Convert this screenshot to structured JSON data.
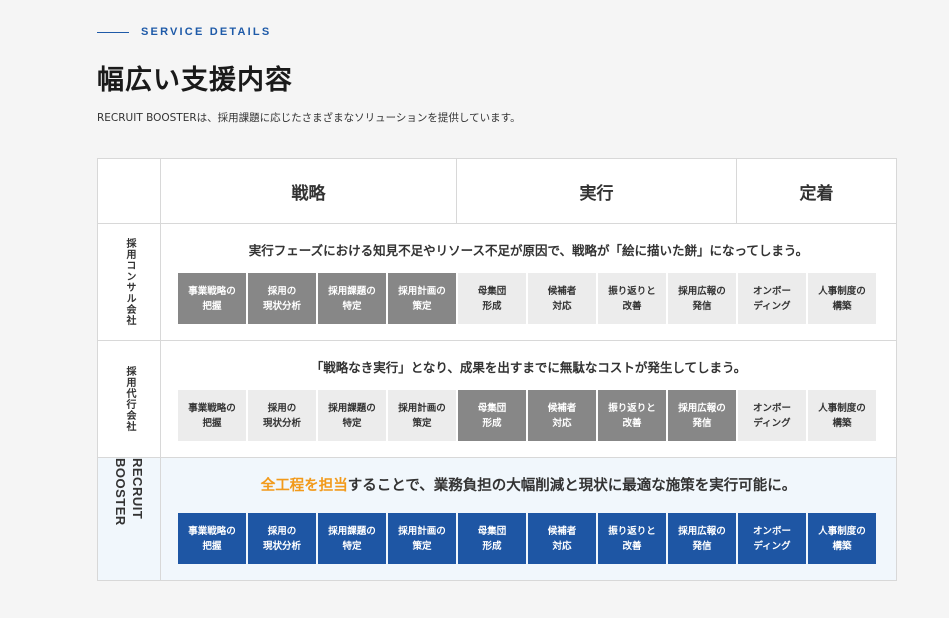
{
  "section": {
    "eyebrow": "SERVICE DETAILS",
    "title": "幅広い支援内容",
    "lead": "RECRUIT BOOSTERは、採用課題に応じたさまざまなソリューションを提供しています。"
  },
  "table": {
    "columns": [
      "戦略",
      "実行",
      "定着"
    ],
    "rows": [
      {
        "label": "採用コンサル会社",
        "message": "実行フェーズにおける知見不足やリソース不足が原因で、戦略が「絵に描いた餅」になってしまう。",
        "chip_states": [
          "gray",
          "gray",
          "gray",
          "gray",
          "off",
          "off",
          "off",
          "off",
          "off",
          "off"
        ]
      },
      {
        "label": "採用代行会社",
        "message": "「戦略なき実行」となり、成果を出すまでに無駄なコストが発生してしまう。",
        "chip_states": [
          "off",
          "off",
          "off",
          "off",
          "gray",
          "gray",
          "gray",
          "gray",
          "off",
          "off"
        ]
      },
      {
        "label": "RECRUIT BOOSTER",
        "message_highlight": "全工程を担当",
        "message_rest": "することで、業務負担の大幅削減と現状に最適な施策を実行可能に。",
        "chip_states": [
          "blue",
          "blue",
          "blue",
          "blue",
          "blue",
          "blue",
          "blue",
          "blue",
          "blue",
          "blue"
        ]
      }
    ],
    "chips": [
      {
        "line1": "事業戦略の",
        "line2": "把握"
      },
      {
        "line1": "採用の",
        "line2": "現状分析"
      },
      {
        "line1": "採用課題の",
        "line2": "特定"
      },
      {
        "line1": "採用計画の",
        "line2": "策定"
      },
      {
        "line1": "母集団",
        "line2": "形成"
      },
      {
        "line1": "候補者",
        "line2": "対応"
      },
      {
        "line1": "振り返りと",
        "line2": "改善"
      },
      {
        "line1": "採用広報の",
        "line2": "発信"
      },
      {
        "line1": "オンボー",
        "line2": "ディング"
      },
      {
        "line1": "人事制度の",
        "line2": "構築"
      }
    ]
  },
  "colors": {
    "accent_blue": "#1e56a4",
    "active_gray": "#878787",
    "inactive": "#ececec",
    "highlight_orange": "#f29a1a"
  }
}
